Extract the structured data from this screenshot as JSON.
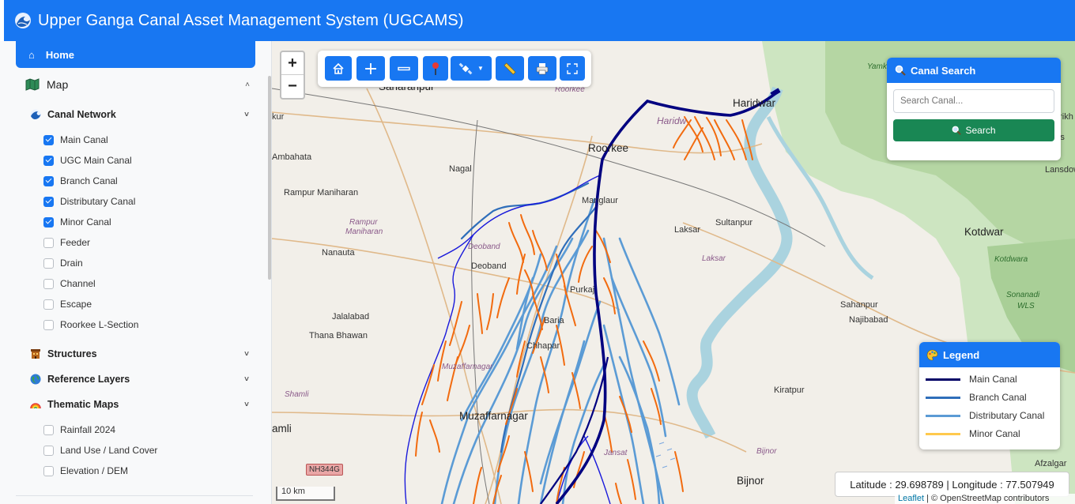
{
  "app": {
    "title": "Upper Ganga Canal Asset Management System (UGCAMS)"
  },
  "sidebar": {
    "home_label": "Home",
    "map_label": "Map",
    "canal_network": {
      "label": "Canal Network",
      "items": [
        {
          "label": "Main Canal",
          "checked": true
        },
        {
          "label": "UGC Main Canal",
          "checked": true
        },
        {
          "label": "Branch Canal",
          "checked": true
        },
        {
          "label": "Distributary Canal",
          "checked": true
        },
        {
          "label": "Minor Canal",
          "checked": true
        },
        {
          "label": "Feeder",
          "checked": false
        },
        {
          "label": "Drain",
          "checked": false
        },
        {
          "label": "Channel",
          "checked": false
        },
        {
          "label": "Escape",
          "checked": false
        },
        {
          "label": "Roorkee L-Section",
          "checked": false
        }
      ]
    },
    "structures_label": "Structures",
    "reference_layers_label": "Reference Layers",
    "thematic_maps": {
      "label": "Thematic Maps",
      "items": [
        {
          "label": "Rainfall 2024",
          "checked": false
        },
        {
          "label": "Land Use / Land Cover",
          "checked": false
        },
        {
          "label": "Elevation / DEM",
          "checked": false
        }
      ]
    }
  },
  "map": {
    "zoom_in": "+",
    "zoom_out": "−",
    "scale_label": "10 km",
    "coords_text": "Latitude : 29.698789 | Longitude : 77.507949",
    "attribution_link": "Leaflet",
    "attribution_rest": " | © OpenStreetMap contributors",
    "road_badge": "NH344G",
    "place_labels": {
      "saharanpur": "Saharanpur",
      "haridwar": "Haridwar",
      "haridwar_dist": "Haridw",
      "roorkee": "Roorkee",
      "roorkee_it": "Roorkee",
      "nagal": "Nagal",
      "manglaur": "Manglaur",
      "laksar": "Laksar",
      "laksar_it": "Laksar",
      "sultanpur": "Sultanpur",
      "kotdwar": "Kotdwar",
      "kotdwara_it": "Kotdwara",
      "ambahata": "Ambahata",
      "rampur": "Rampur Maniharan",
      "rampur_it1": "Rampur",
      "rampur_it2": "Maniharan",
      "nanauta": "Nanauta",
      "deoband": "Deoband",
      "deoband_it": "Deoband",
      "purkaji": "Purkaj",
      "jalalabad": "Jalalabad",
      "thana": "Thana Bhawan",
      "baria": "Baria",
      "chhapar": "Chhapar",
      "muzaffarnagar": "Muzaffarnagar",
      "muzaffarnagar_it": "Muzaffarnagar",
      "shamli_it": "Shamli",
      "shamli": "amli",
      "jansath_it": "Jansat",
      "bijnor": "Bijnor",
      "bijnor_it": "Bijnor",
      "kiratpur": "Kiratpur",
      "sahanpur": "Sahanpur",
      "najibabad": "Najibabad",
      "sonanadi1": "Sonanadi",
      "sonanadi2": "WLS",
      "afzalgarh": "Afzalgar",
      "lansdowne": "Lansdow",
      "yamk": "Yamk",
      "rikh": "arikh",
      "kur": "kur",
      "as": "As"
    }
  },
  "toolbar": {
    "buttons": [
      "home-icon",
      "zoom-in-icon",
      "zoom-out-icon",
      "marker-icon",
      "satellite-icon",
      "ruler-icon",
      "print-icon",
      "fullscreen-icon"
    ]
  },
  "search": {
    "title": "Canal Search",
    "placeholder": "Search Canal...",
    "button_label": "Search"
  },
  "legend": {
    "title": "Legend",
    "items": [
      {
        "label": "Main Canal",
        "color": "#000066"
      },
      {
        "label": "Branch Canal",
        "color": "#2f6eba"
      },
      {
        "label": "Distributary Canal",
        "color": "#5b9bd5"
      },
      {
        "label": "Minor Canal",
        "color": "#ffc94d"
      }
    ]
  },
  "colors": {
    "accent": "#1877f2",
    "search_button": "#198754",
    "main_canal": "#000080",
    "minor_canal": "#f26b0f"
  }
}
